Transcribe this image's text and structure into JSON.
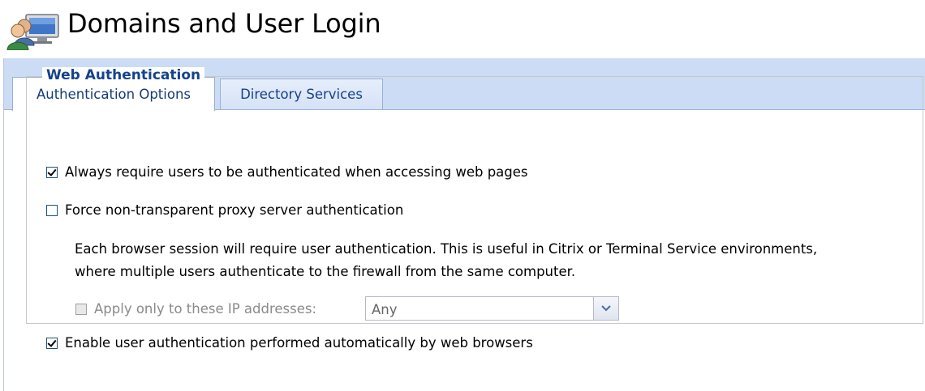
{
  "header": {
    "icon": "users-computer-icon",
    "title": "Domains and User Login"
  },
  "tabs": [
    {
      "label": "Authentication Options",
      "active": true
    },
    {
      "label": "Directory Services",
      "active": false
    }
  ],
  "web_authentication": {
    "title": "Web Authentication",
    "always_require": {
      "label": "Always require users to be authenticated when accessing web pages",
      "checked": true
    },
    "force_non_transparent": {
      "label": "Force non-transparent proxy server authentication",
      "checked": false
    },
    "description_line1": "Each browser session will require user authentication. This is useful in Citrix or Terminal Service environments,",
    "description_line2": "where multiple users authenticate to the firewall from the same computer.",
    "apply_only": {
      "label": "Apply only to these IP addresses:",
      "checked": false,
      "disabled": true
    },
    "ip_select": {
      "value": "Any"
    },
    "enable_auto": {
      "label": "Enable user authentication performed automatically by web browsers",
      "checked": true
    }
  },
  "colors": {
    "tab_strip": "#ccdcf5",
    "title_blue": "#15428b",
    "border": "#99b0d6"
  }
}
